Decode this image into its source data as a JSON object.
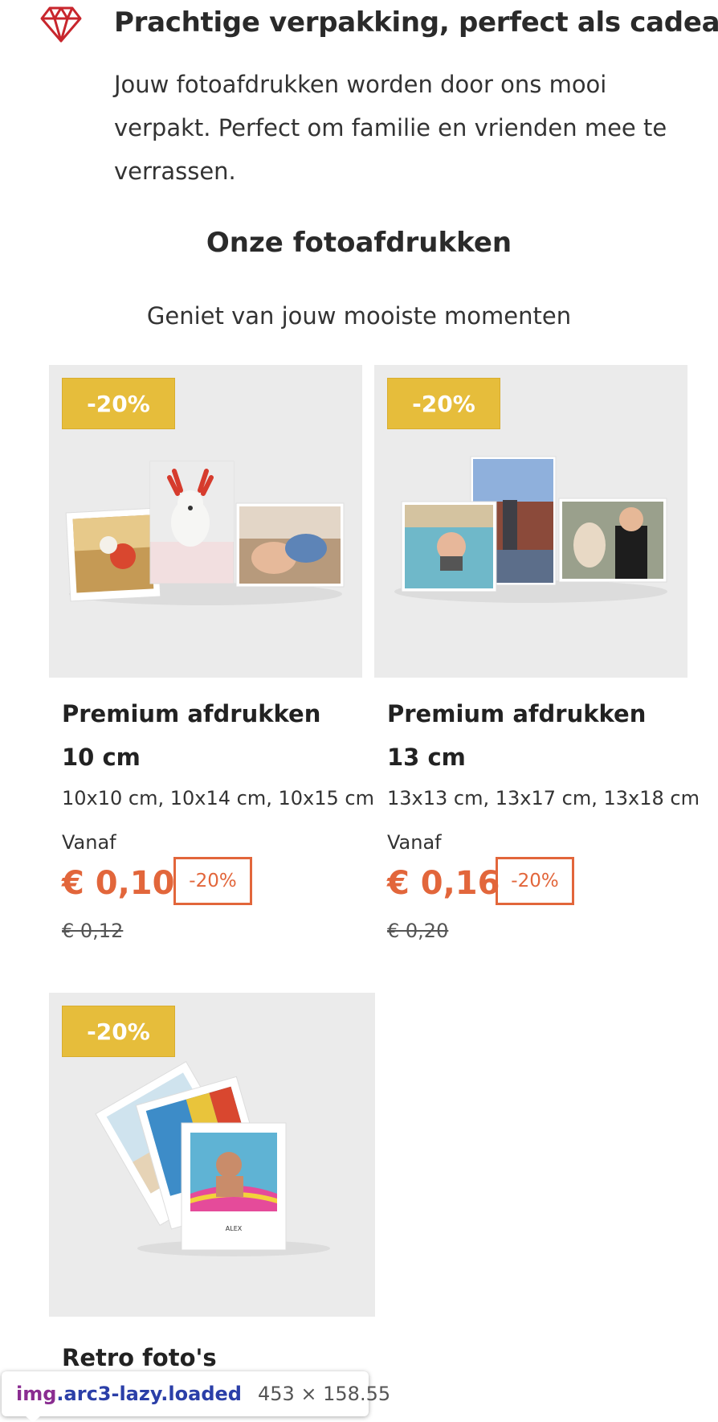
{
  "feature": {
    "icon": "diamond-icon",
    "icon_color": "#c8262d",
    "title": "Prachtige verpakking, perfect als cadeau",
    "text": "Jouw fotoafdrukken worden door ons mooi verpakt. Perfect om familie en vrienden mee te verrassen."
  },
  "section": {
    "title": "Onze fotoafdrukken",
    "subtitle": "Geniet van jouw mooiste momenten"
  },
  "colors": {
    "badge": "#e6bd3b",
    "price": "#e2663b"
  },
  "products": [
    {
      "badge": "-20%",
      "title": "Premium afdrukken 10 cm",
      "sizes": "10x10 cm, 10x14 cm, 10x15 cm",
      "from_label": "Vanaf",
      "price": "€ 0,10",
      "price_badge": "-20%",
      "old_price": "€ 0,12"
    },
    {
      "badge": "-20%",
      "title": "Premium afdrukken 13 cm",
      "sizes": "13x13 cm, 13x17 cm, 13x18 cm",
      "from_label": "Vanaf",
      "price": "€ 0,16",
      "price_badge": "-20%",
      "old_price": "€ 0,20"
    },
    {
      "badge": "-20%",
      "title": "Retro foto's",
      "photo_caption": "ALEX"
    }
  ],
  "devtools_tooltip": {
    "tag": "img",
    "classes": ".arc3-lazy.loaded",
    "dimensions": "453 × 158.55"
  }
}
